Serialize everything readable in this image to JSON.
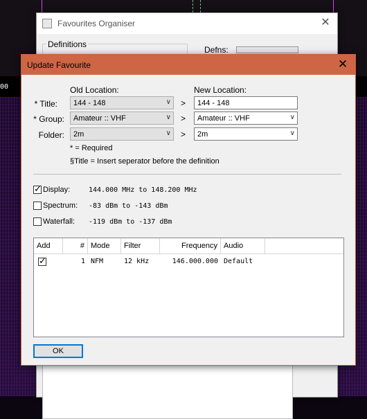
{
  "background": {
    "scale_label": "00"
  },
  "organiser": {
    "title": "Favourites Organiser",
    "definitions_label": "Definitions",
    "defns_label": "Defns:"
  },
  "dialog": {
    "title": "Update Favourite",
    "old_location_header": "Old Location:",
    "new_location_header": "New Location:",
    "fields": {
      "title_label": "* Title:",
      "group_label": "* Group:",
      "folder_label": "Folder:",
      "old_title": "144 - 148",
      "old_group": "Amateur :: VHF",
      "old_folder": "2m",
      "new_title": "144 - 148",
      "new_group": "Amateur :: VHF",
      "new_folder": "2m",
      "arrow": ">"
    },
    "notes": {
      "required": "* = Required",
      "separator": "§Title = Insert seperator before the definition"
    },
    "options": {
      "display_label": "Display:",
      "display_checked": true,
      "display_value": "144.000 MHz to 148.200 MHz",
      "spectrum_label": "Spectrum:",
      "spectrum_checked": false,
      "spectrum_value": "-83 dBm to -143 dBm",
      "waterfall_label": "Waterfall:",
      "waterfall_checked": false,
      "waterfall_value": "-119 dBm to -137 dBm"
    },
    "table": {
      "columns": [
        "Add",
        "#",
        "Mode",
        "Filter",
        "Frequency",
        "Audio"
      ],
      "rows": [
        {
          "add": true,
          "num": "1",
          "mode": "NFM",
          "filter": "12 kHz",
          "frequency": "146.000.000",
          "audio": "Default"
        }
      ]
    },
    "ok_label": "OK"
  },
  "colors": {
    "title_bar": "#ce6545",
    "focus_blue": "#0078d7",
    "marker": "#e040ff"
  }
}
